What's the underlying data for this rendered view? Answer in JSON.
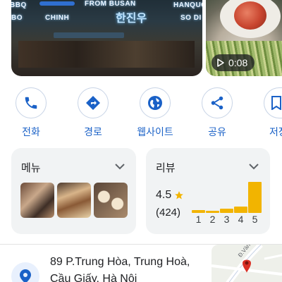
{
  "photos": {
    "storefront_sign": {
      "line_left": "BBQ",
      "line_left2": "BO",
      "line_left3": "CHINH",
      "line_center": "FROM BUSAN",
      "line_right": "HANQUOC",
      "line_right2": "SO DI",
      "korean": "한진우"
    },
    "video_duration": "0:08"
  },
  "actions": [
    {
      "label": "전화",
      "icon": "phone-icon"
    },
    {
      "label": "경로",
      "icon": "directions-icon"
    },
    {
      "label": "웹사이트",
      "icon": "globe-icon"
    },
    {
      "label": "공유",
      "icon": "share-icon"
    },
    {
      "label": "저장",
      "icon": "bookmark-icon"
    }
  ],
  "menu_card": {
    "title": "메뉴"
  },
  "reviews_card": {
    "title": "리뷰",
    "rating": "4.5",
    "count": "(424)"
  },
  "chart_data": {
    "type": "bar",
    "categories": [
      "1",
      "2",
      "3",
      "4",
      "5"
    ],
    "values": [
      4,
      3,
      6,
      9,
      44
    ],
    "ylim": [
      0,
      46
    ]
  },
  "address": {
    "line1": "89 P.Trung Hòa, Trung Hoà,",
    "line2": "Cầu Giấy, Hà Nội"
  },
  "map": {
    "street_label": "Đ.Vành Đai"
  },
  "colors": {
    "accent": "#1a61c7",
    "star": "#f2b400",
    "card_bg": "#f1f3f4",
    "pin": "#d93025"
  }
}
